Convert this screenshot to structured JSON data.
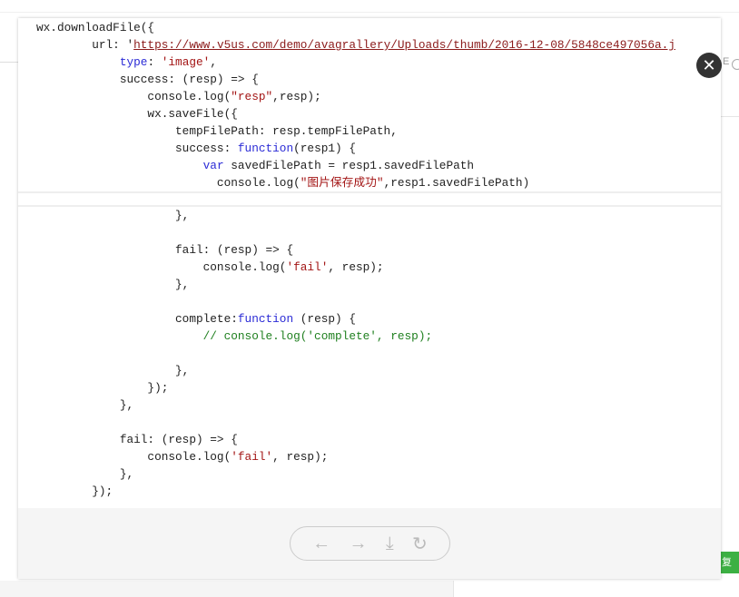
{
  "background": {
    "right_text": "E",
    "green_button": "复"
  },
  "code": {
    "block1": [
      {
        "parts": [
          [
            "",
            "wx.downloadFile({"
          ]
        ]
      },
      {
        "parts": [
          [
            "",
            "        url: '"
          ],
          [
            "url",
            "https://www.v5us.com/demo/avagrallery/Uploads/thumb/2016-12-08/5848ce497056a.j"
          ]
        ]
      },
      {
        "parts": [
          [
            "",
            "            "
          ],
          [
            "kw",
            "type"
          ],
          [
            "",
            ": "
          ],
          [
            "str",
            "'image'"
          ],
          [
            "",
            ","
          ]
        ]
      },
      {
        "parts": [
          [
            "",
            "            success: (resp) => {"
          ]
        ]
      },
      {
        "parts": [
          [
            "",
            "                console.log("
          ],
          [
            "str",
            "\"resp\""
          ],
          [
            "",
            ",resp);"
          ]
        ]
      },
      {
        "parts": [
          [
            "",
            "                wx.saveFile({"
          ]
        ]
      },
      {
        "parts": [
          [
            "",
            "                    tempFilePath: resp.tempFilePath,"
          ]
        ]
      },
      {
        "parts": [
          [
            "",
            "                    success: "
          ],
          [
            "kw",
            "function"
          ],
          [
            "",
            "(resp1) {"
          ]
        ]
      },
      {
        "parts": [
          [
            "",
            "                        "
          ],
          [
            "kw",
            "var"
          ],
          [
            "",
            " savedFilePath = resp1.savedFilePath"
          ]
        ]
      },
      {
        "parts": [
          [
            "",
            "                          console.log("
          ],
          [
            "str",
            "\"图片保存成功\""
          ],
          [
            "",
            ",resp1.savedFilePath)"
          ]
        ]
      }
    ],
    "block2": [
      {
        "parts": [
          [
            "",
            "                    },"
          ]
        ]
      },
      {
        "parts": [
          [
            "",
            ""
          ]
        ]
      },
      {
        "parts": [
          [
            "",
            "                    fail: (resp) => {"
          ]
        ]
      },
      {
        "parts": [
          [
            "",
            "                        console.log("
          ],
          [
            "str",
            "'fail'"
          ],
          [
            "",
            ", resp);"
          ]
        ]
      },
      {
        "parts": [
          [
            "",
            "                    },"
          ]
        ]
      },
      {
        "parts": [
          [
            "",
            ""
          ]
        ]
      },
      {
        "parts": [
          [
            "",
            "                    complete:"
          ],
          [
            "kw",
            "function"
          ],
          [
            "",
            " (resp) {"
          ]
        ]
      },
      {
        "parts": [
          [
            "",
            "                        "
          ],
          [
            "cm",
            "// console.log('complete', resp);"
          ]
        ]
      },
      {
        "parts": [
          [
            "",
            ""
          ]
        ]
      },
      {
        "parts": [
          [
            "",
            "                    },"
          ]
        ]
      },
      {
        "parts": [
          [
            "",
            "                });"
          ]
        ]
      },
      {
        "parts": [
          [
            "",
            "            },"
          ]
        ]
      },
      {
        "parts": [
          [
            "",
            ""
          ]
        ]
      },
      {
        "parts": [
          [
            "",
            "            fail: (resp) => {"
          ]
        ]
      },
      {
        "parts": [
          [
            "",
            "                console.log("
          ],
          [
            "str",
            "'fail'"
          ],
          [
            "",
            ", resp);"
          ]
        ]
      },
      {
        "parts": [
          [
            "",
            "            },"
          ]
        ]
      },
      {
        "parts": [
          [
            "",
            "        });"
          ]
        ]
      }
    ]
  },
  "toolbar": {
    "prev": "←",
    "next": "→",
    "download": "⤓",
    "rotate": "↻",
    "close": "✕"
  }
}
